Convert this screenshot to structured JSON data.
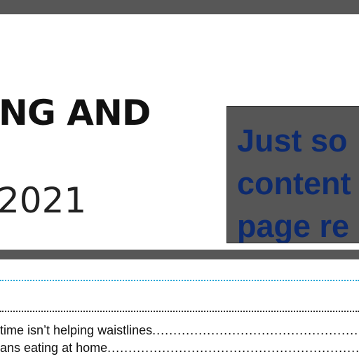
{
  "document": {
    "title_line": "NG AND",
    "year": "2021"
  },
  "overlay": {
    "lines": [
      "Just so",
      "content",
      "page re"
    ]
  },
  "toc": {
    "entries": [
      {
        "label": "time isn’t helping waistlines"
      },
      {
        "label": "ans eating at home"
      }
    ]
  },
  "colors": {
    "chrome_bar": "#575757",
    "overlay_bg": "#565656",
    "overlay_text": "#0d2a6e",
    "accent_rule": "#29a8d8"
  }
}
